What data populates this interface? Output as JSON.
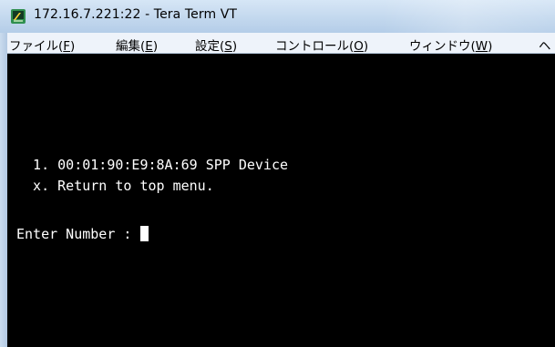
{
  "window": {
    "title": "172.16.7.221:22 - Tera Term VT"
  },
  "menu": {
    "items": [
      {
        "label": "ファイル(",
        "key": "F",
        "suffix": ")"
      },
      {
        "label": "編集(",
        "key": "E",
        "suffix": ")"
      },
      {
        "label": "設定(",
        "key": "S",
        "suffix": ")"
      },
      {
        "label": "コントロール(",
        "key": "O",
        "suffix": ")"
      },
      {
        "label": "ウィンドウ(",
        "key": "W",
        "suffix": ")"
      },
      {
        "label": "ヘ",
        "key": "",
        "suffix": ""
      }
    ]
  },
  "terminal": {
    "lines": [
      "  1. 00:01:90:E9:8A:69 SPP Device",
      "  x. Return to top menu."
    ],
    "prompt": "Enter Number : "
  },
  "colors": {
    "terminal_bg": "#000000",
    "terminal_fg": "#ffffff",
    "titlebar": "#c3d8ee",
    "menubar": "#eef3fa"
  },
  "icons": {
    "app": "tera-term-icon"
  }
}
